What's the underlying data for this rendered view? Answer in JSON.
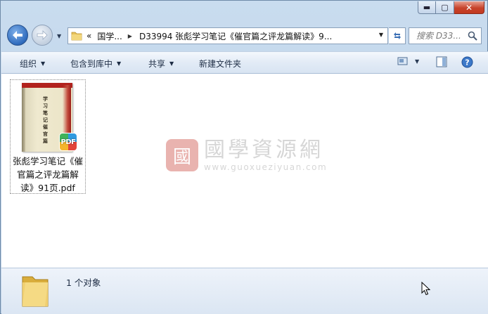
{
  "window": {
    "minimize_glyph": "▬",
    "maximize_glyph": "▢",
    "close_glyph": "✕"
  },
  "address": {
    "overflow": "«",
    "crumb_parent": "国学...",
    "crumb_current": "D33994 张彪学习笔记《催官篇之评龙篇解读》9..."
  },
  "search": {
    "placeholder": "搜索 D33..."
  },
  "toolbar": {
    "organize": "组织",
    "include_library": "包含到库中",
    "share": "共享",
    "new_folder": "新建文件夹"
  },
  "file": {
    "name": "张彪学习笔记《催官篇之评龙篇解读》91页.pdf",
    "badge": "PDF",
    "thumb_label": "PDF",
    "cover_text": "学习笔记催官篇"
  },
  "watermark": {
    "logo_char": "國",
    "name": "國學資源網",
    "url": "www.guoxueziyuan.com"
  },
  "details": {
    "count_text": "1 个对象"
  },
  "colors": {
    "accent": "#2f6bbd",
    "close_red": "#c7432b",
    "folder_yellow": "#e7c15a"
  }
}
